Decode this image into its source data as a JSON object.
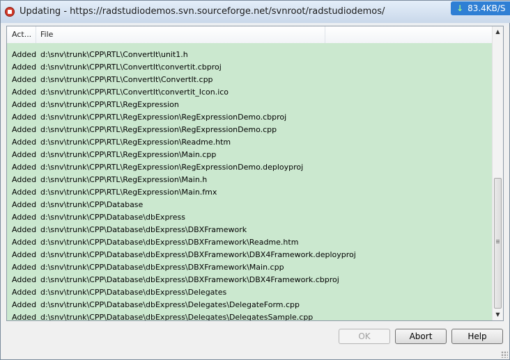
{
  "window": {
    "title": "Updating - https://radstudiodemos.svn.sourceforge.net/svnroot/radstudiodemos/",
    "speed": "83.4KB/S"
  },
  "list": {
    "columns": [
      "Act...",
      "File"
    ],
    "rows": [
      {
        "action": "Added",
        "file": "d:\\snv\\trunk\\CPP\\RTL\\ConvertIt\\unit1.h"
      },
      {
        "action": "Added",
        "file": "d:\\snv\\trunk\\CPP\\RTL\\ConvertIt\\convertit.cbproj"
      },
      {
        "action": "Added",
        "file": "d:\\snv\\trunk\\CPP\\RTL\\ConvertIt\\ConvertIt.cpp"
      },
      {
        "action": "Added",
        "file": "d:\\snv\\trunk\\CPP\\RTL\\ConvertIt\\convertit_Icon.ico"
      },
      {
        "action": "Added",
        "file": "d:\\snv\\trunk\\CPP\\RTL\\RegExpression"
      },
      {
        "action": "Added",
        "file": "d:\\snv\\trunk\\CPP\\RTL\\RegExpression\\RegExpressionDemo.cbproj"
      },
      {
        "action": "Added",
        "file": "d:\\snv\\trunk\\CPP\\RTL\\RegExpression\\RegExpressionDemo.cpp"
      },
      {
        "action": "Added",
        "file": "d:\\snv\\trunk\\CPP\\RTL\\RegExpression\\Readme.htm"
      },
      {
        "action": "Added",
        "file": "d:\\snv\\trunk\\CPP\\RTL\\RegExpression\\Main.cpp"
      },
      {
        "action": "Added",
        "file": "d:\\snv\\trunk\\CPP\\RTL\\RegExpression\\RegExpressionDemo.deployproj"
      },
      {
        "action": "Added",
        "file": "d:\\snv\\trunk\\CPP\\RTL\\RegExpression\\Main.h"
      },
      {
        "action": "Added",
        "file": "d:\\snv\\trunk\\CPP\\RTL\\RegExpression\\Main.fmx"
      },
      {
        "action": "Added",
        "file": "d:\\snv\\trunk\\CPP\\Database"
      },
      {
        "action": "Added",
        "file": "d:\\snv\\trunk\\CPP\\Database\\dbExpress"
      },
      {
        "action": "Added",
        "file": "d:\\snv\\trunk\\CPP\\Database\\dbExpress\\DBXFramework"
      },
      {
        "action": "Added",
        "file": "d:\\snv\\trunk\\CPP\\Database\\dbExpress\\DBXFramework\\Readme.htm"
      },
      {
        "action": "Added",
        "file": "d:\\snv\\trunk\\CPP\\Database\\dbExpress\\DBXFramework\\DBX4Framework.deployproj"
      },
      {
        "action": "Added",
        "file": "d:\\snv\\trunk\\CPP\\Database\\dbExpress\\DBXFramework\\Main.cpp"
      },
      {
        "action": "Added",
        "file": "d:\\snv\\trunk\\CPP\\Database\\dbExpress\\DBXFramework\\DBX4Framework.cbproj"
      },
      {
        "action": "Added",
        "file": "d:\\snv\\trunk\\CPP\\Database\\dbExpress\\Delegates"
      },
      {
        "action": "Added",
        "file": "d:\\snv\\trunk\\CPP\\Database\\dbExpress\\Delegates\\DelegateForm.cpp"
      },
      {
        "action": "Added",
        "file": "d:\\snv\\trunk\\CPP\\Database\\dbExpress\\Delegates\\DelegatesSample.cpp"
      }
    ]
  },
  "buttons": {
    "ok": "OK",
    "abort": "Abort",
    "help": "Help"
  },
  "colors": {
    "row_background": "#cbe8cf",
    "speed_badge": "#2f7fd4"
  }
}
